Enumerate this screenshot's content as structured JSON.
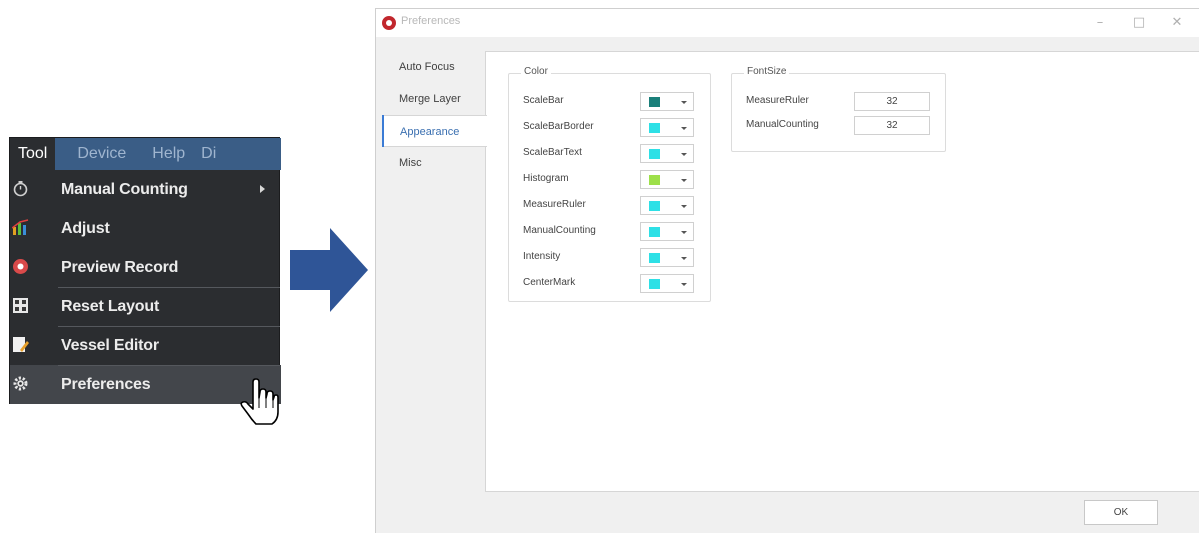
{
  "menu": {
    "menubar": [
      "Tool",
      "Device",
      "Help",
      "Di"
    ],
    "items": [
      {
        "label": "Manual Counting",
        "icon": "timer-icon",
        "submenu": true
      },
      {
        "label": "Adjust",
        "icon": "adjust-icon",
        "submenu": false
      },
      {
        "label": "Preview Record",
        "icon": "record-icon",
        "submenu": false
      },
      {
        "label": "Reset Layout",
        "icon": "layout-icon",
        "submenu": false
      },
      {
        "label": "Vessel Editor",
        "icon": "vessel-editor-icon",
        "submenu": false
      },
      {
        "label": "Preferences",
        "icon": "gear-icon",
        "submenu": false
      }
    ]
  },
  "dialog": {
    "title": "Preferences",
    "tabs": [
      "Auto Focus",
      "Merge Layer",
      "Appearance",
      "Misc"
    ],
    "selected_tab": "Appearance",
    "color_group": {
      "title": "Color",
      "rows": [
        {
          "label": "ScaleBar",
          "color": "#1a7f7a"
        },
        {
          "label": "ScaleBarBorder",
          "color": "#2ee0e6"
        },
        {
          "label": "ScaleBarText",
          "color": "#2ee0e6"
        },
        {
          "label": "Histogram",
          "color": "#9ee04a"
        },
        {
          "label": "MeasureRuler",
          "color": "#2ee0e6"
        },
        {
          "label": "ManualCounting",
          "color": "#2ee0e6"
        },
        {
          "label": "Intensity",
          "color": "#2ee0e6"
        },
        {
          "label": "CenterMark",
          "color": "#2ee0e6"
        }
      ]
    },
    "font_group": {
      "title": "FontSize",
      "rows": [
        {
          "label": "MeasureRuler",
          "value": "32"
        },
        {
          "label": "ManualCounting",
          "value": "32"
        }
      ]
    },
    "ok_label": "OK"
  },
  "colors": {
    "arrow": "#2f5597",
    "menubar": "#3a5d86",
    "menu_bg": "#2b2d30"
  }
}
